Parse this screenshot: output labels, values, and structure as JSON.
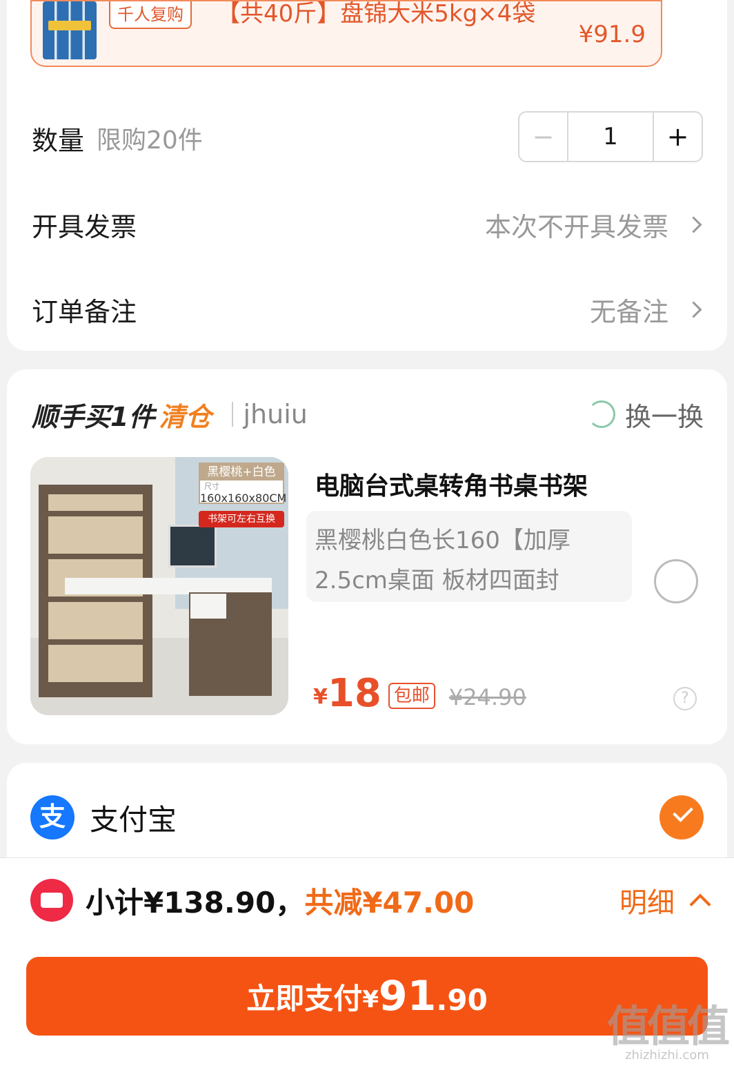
{
  "featured": {
    "badge": "千人复购",
    "title": "【共40斤】盘锦大米5kg×4袋",
    "price": "¥91.9"
  },
  "quantity": {
    "label": "数量",
    "limit": "限购20件",
    "minus": "−",
    "value": "1",
    "plus": "+"
  },
  "invoice": {
    "label": "开具发票",
    "value": "本次不开具发票"
  },
  "remark": {
    "label": "订单备注",
    "value": "无备注"
  },
  "addon": {
    "title": "顺手买1件",
    "hot": "清仓",
    "brand": "jhuiu",
    "swap": "换一换",
    "image": {
      "tag_title": "黑樱桃+白色",
      "tag_size_label": "尺寸",
      "tag_size": "160x160x80CM",
      "tag_note": "书架可左右互换"
    },
    "name": "电脑台式桌转角书桌书架",
    "spec": "黑樱桃白色长160【加厚2.5cm桌面 板材四面封",
    "price_currency": "¥",
    "price": "18",
    "shipping": "包邮",
    "original_price": "¥24.90",
    "help": "?"
  },
  "payment": {
    "name": "支付宝",
    "icon_glyph": "支"
  },
  "summary": {
    "subtotal": "小计¥138.90，",
    "discount": "共减¥47.00",
    "detail": "明细"
  },
  "pay_button": {
    "label": "立即支付",
    "currency": "¥",
    "amount_int": "91",
    "amount_dec": ".90"
  },
  "watermark": {
    "logo": "值值值",
    "url": "zhizhizhi.com"
  },
  "colors": {
    "accent": "#f55314",
    "discount": "#f06a18",
    "alipay": "#1677ff",
    "coupon": "#ee2a45"
  }
}
